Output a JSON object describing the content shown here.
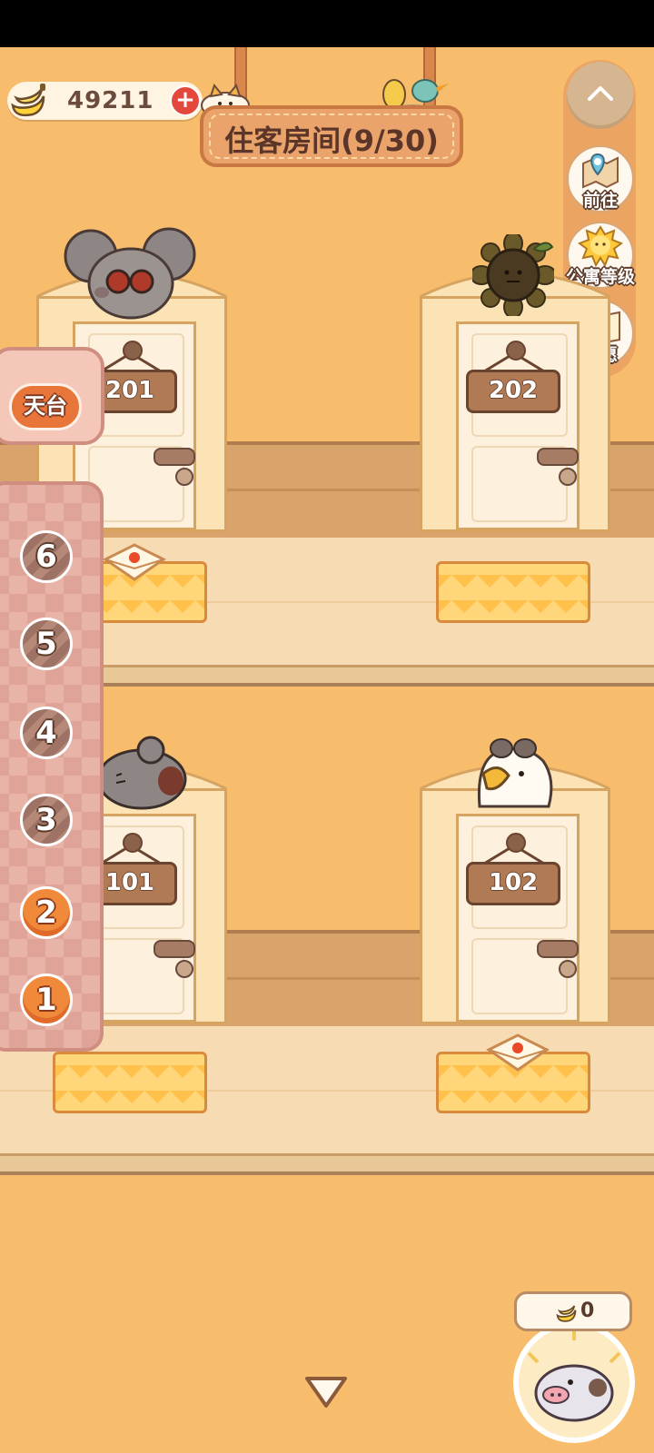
{
  "header": {
    "currency": {
      "amount": "49211",
      "icon": "banana-icon",
      "add_icon": "plus-icon"
    },
    "title": "住客房间(9/30)"
  },
  "side_menu": {
    "collapse_icon": "chevron-up-icon",
    "items": [
      {
        "label": "前往",
        "icon": "map-pin-icon"
      },
      {
        "label": "公寓等级",
        "icon": "sun-cat-icon"
      },
      {
        "label": "心愿",
        "icon": "heart-book-icon"
      }
    ]
  },
  "floor_nav": {
    "rooftop_label": "天台",
    "floors": [
      {
        "label": "6",
        "state": "inactive"
      },
      {
        "label": "5",
        "state": "inactive"
      },
      {
        "label": "4",
        "state": "inactive"
      },
      {
        "label": "3",
        "state": "inactive"
      },
      {
        "label": "2",
        "state": "active"
      },
      {
        "label": "1",
        "state": "active"
      }
    ]
  },
  "rooms": [
    {
      "number": "201",
      "tenant": "gray-mouse-with-goggles",
      "has_letter": true
    },
    {
      "number": "202",
      "tenant": "sunflower",
      "has_letter": false
    },
    {
      "number": "101",
      "tenant": "gray-spotted-cat",
      "has_letter": false
    },
    {
      "number": "102",
      "tenant": "white-bird-with-goggles",
      "has_letter": true
    }
  ],
  "piggy_bank": {
    "count": "0",
    "icon": "pig-icon"
  },
  "scroll_down_icon": "triangle-down-icon",
  "colors": {
    "background": "#f8bd6c",
    "accent": "#f08a3a",
    "text_dark": "#5a3528"
  }
}
